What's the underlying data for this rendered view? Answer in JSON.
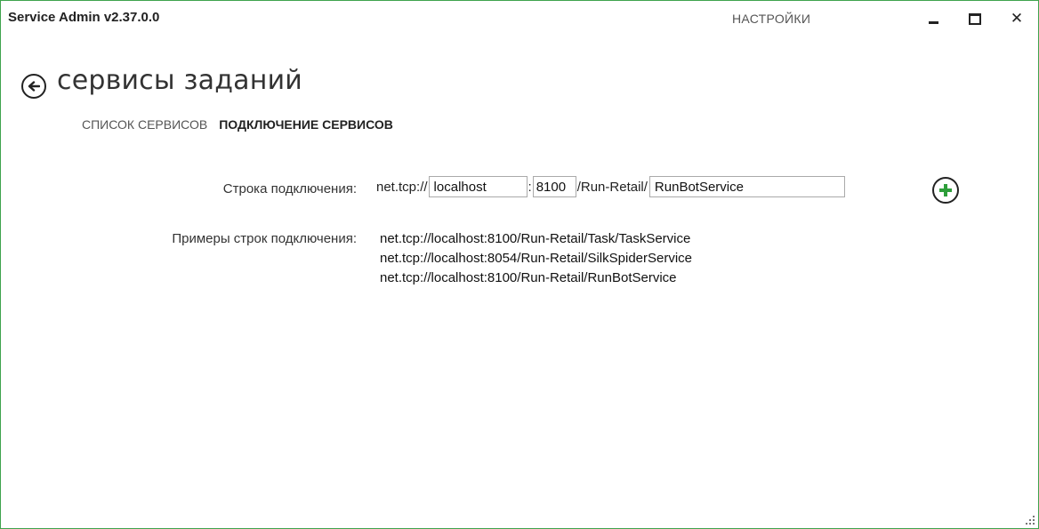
{
  "window": {
    "title": "Service Admin  v2.37.0.0",
    "settings_label": "НАСТРОЙКИ",
    "minimize_icon": "minimize-icon",
    "maximize_icon": "maximize-icon",
    "close_label": "✕",
    "border_color": "#3fa34d"
  },
  "page": {
    "title": "сервисы заданий",
    "back_icon": "arrow-left-icon"
  },
  "tabs": [
    {
      "label": "СПИСОК СЕРВИСОВ",
      "active": false
    },
    {
      "label": "ПОДКЛЮЧЕНИЕ СЕРВИСОВ",
      "active": true
    }
  ],
  "connection": {
    "label": "Строка подключения:",
    "prefix": "net.tcp://",
    "host_value": "localhost",
    "colon": ":",
    "port_value": "8100",
    "path_text": "/Run-Retail/",
    "service_value": "RunBotService",
    "add_icon": "plus-circle-icon",
    "add_icon_color": "#2e9e3a"
  },
  "examples": {
    "label": "Примеры строк подключения:",
    "items": [
      "net.tcp://localhost:8100/Run-Retail/Task/TaskService",
      "net.tcp://localhost:8054/Run-Retail/SilkSpiderService",
      "net.tcp://localhost:8100/Run-Retail/RunBotService"
    ]
  }
}
